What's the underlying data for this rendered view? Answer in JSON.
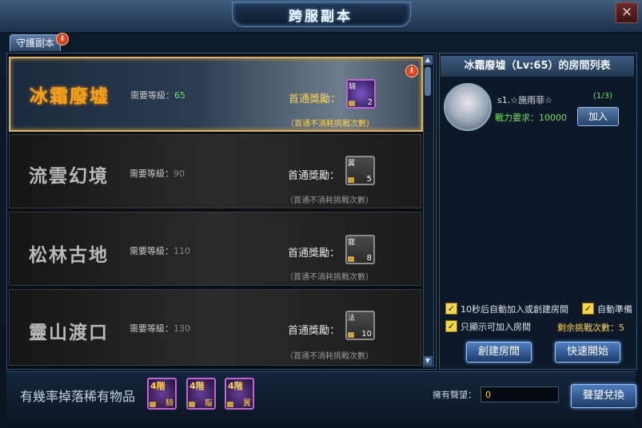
{
  "window": {
    "title": "跨服副本",
    "close_label": "×"
  },
  "tabs": [
    {
      "label": "守護副本",
      "alert": "!"
    }
  ],
  "dungeons": [
    {
      "name": "冰霜廢墟",
      "req_label": "需要等級：",
      "req_level": "65",
      "reward_label": "首通獎勵：",
      "reward_count": "2",
      "reward_tag": "騎",
      "note": "（首通不消耗挑戰次數）",
      "alert": "!",
      "selected": true
    },
    {
      "name": "流雲幻境",
      "req_label": "需要等級：",
      "req_level": "90",
      "reward_label": "首通獎勵：",
      "reward_count": "5",
      "reward_tag": "翼",
      "note": "（首通不消耗挑戰次數）",
      "selected": false
    },
    {
      "name": "松林古地",
      "req_label": "需要等級：",
      "req_level": "110",
      "reward_label": "首通獎勵：",
      "reward_count": "8",
      "reward_tag": "寵",
      "note": "（首通不消耗挑戰次數）",
      "selected": false
    },
    {
      "name": "靈山渡口",
      "req_label": "需要等級：",
      "req_level": "130",
      "reward_label": "首通獎勵：",
      "reward_count": "10",
      "reward_tag": "法",
      "note": "（首通不消耗挑戰次數）",
      "selected": false
    }
  ],
  "room_panel": {
    "title": "冰霜廢墟（Lv:65）的房間列表",
    "player": {
      "name": "s1.☆施雨菲☆",
      "count": "(1/3)",
      "power": "戰力要求：10000",
      "join_label": "加入"
    },
    "options": [
      {
        "label": "10秒后自動加入或創建房間",
        "checked": true
      },
      {
        "label": "自動準備",
        "checked": true
      },
      {
        "label": "只顯示可加入房間",
        "checked": true
      }
    ],
    "remaining": "剩余挑戰次數：5",
    "create_label": "創建房間",
    "quick_label": "快速開始"
  },
  "bottom": {
    "drop_text": "有幾率掉落稀有物品",
    "drops": [
      {
        "level": "4階",
        "kind": "騎"
      },
      {
        "level": "4階",
        "kind": "寵"
      },
      {
        "level": "4階",
        "kind": "翼"
      }
    ],
    "reputation_label": "擁有聲望：",
    "reputation_value": "0",
    "exchange_label": "聲望兌換"
  },
  "colors": {
    "accent_gold": "#ffd34a",
    "accent_green": "#6ee05c",
    "select_border": "#d7b36b"
  }
}
